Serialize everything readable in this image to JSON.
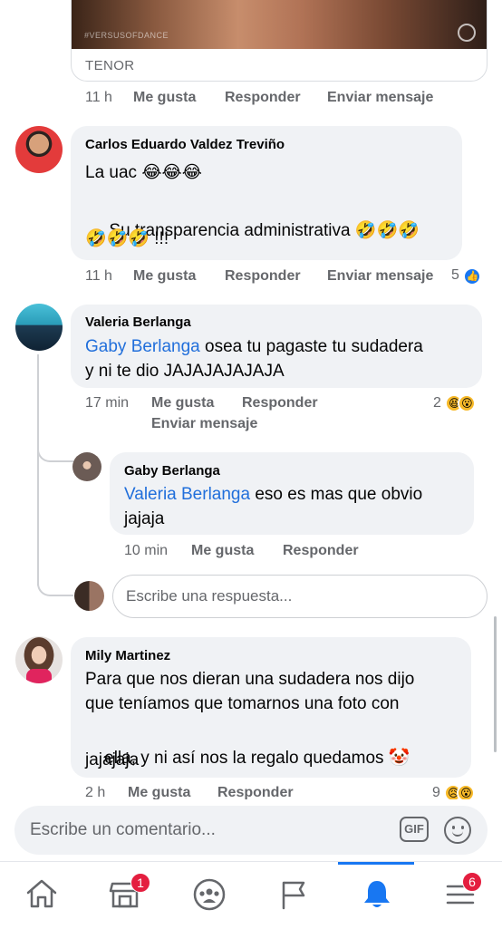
{
  "gif_card": {
    "source": "TENOR",
    "watermark": "#VERSUSOFDANCE"
  },
  "actions": {
    "like": "Me gusta",
    "reply": "Responder",
    "message": "Enviar mensaje"
  },
  "comments": [
    {
      "time": "11 h"
    },
    {
      "author": "Carlos Eduardo Valdez Treviño",
      "line1_text": "La uac ",
      "line1_emoji": "😂😂😂",
      "line2_text": " Su transparencia administrativa ",
      "line2_emoji": "🤣🤣🤣",
      "line3_emoji": "🤣🤣🤣",
      "line3_text": " !!!",
      "time": "11 h",
      "reaction_count": "5",
      "reaction_icons": [
        "like-icon"
      ]
    },
    {
      "author": "Valeria Berlanga",
      "mention": "Gaby Berlanga",
      "text_rest": " osea tu pagaste tu sudadera",
      "line2": "y ni te dio JAJAJAJAJAJA",
      "time": "17 min",
      "reaction_count": "2",
      "reaction_icons": [
        "haha-icon",
        "wow-icon"
      ]
    },
    {
      "author": "Gaby Berlanga",
      "mention": "Valeria Berlanga",
      "text_rest": " eso es mas que obvio",
      "line2": "jajaja",
      "time": "10 min"
    },
    {
      "author": "Mily Martinez",
      "line1": "Para que nos dieran una sudadera nos dijo",
      "line2": "que teníamos que tomarnos una foto con",
      "line3": "ella, y ni así nos la regalo quedamos ",
      "line3_emoji": "🤡",
      "line4": "jajajaja",
      "time": "2 h",
      "reaction_count": "9",
      "reaction_icons": [
        "sad-icon",
        "wow-icon"
      ]
    }
  ],
  "reply_input": {
    "placeholder": "Escribe una respuesta..."
  },
  "composer": {
    "placeholder": "Escribe un comentario...",
    "gif_label": "GIF"
  },
  "tabbar": {
    "tabs": [
      {
        "name": "home",
        "icon": "home-icon"
      },
      {
        "name": "marketplace",
        "icon": "marketplace-icon",
        "badge": "1"
      },
      {
        "name": "groups",
        "icon": "groups-icon"
      },
      {
        "name": "pages",
        "icon": "flag-icon"
      },
      {
        "name": "notifications",
        "icon": "bell-icon",
        "active": true
      },
      {
        "name": "menu",
        "icon": "menu-icon",
        "badge": "6"
      }
    ]
  },
  "colors": {
    "accent": "#1877f2",
    "badge": "#e41e3f",
    "mention": "#216fdb",
    "bubble": "#f0f2f5"
  }
}
